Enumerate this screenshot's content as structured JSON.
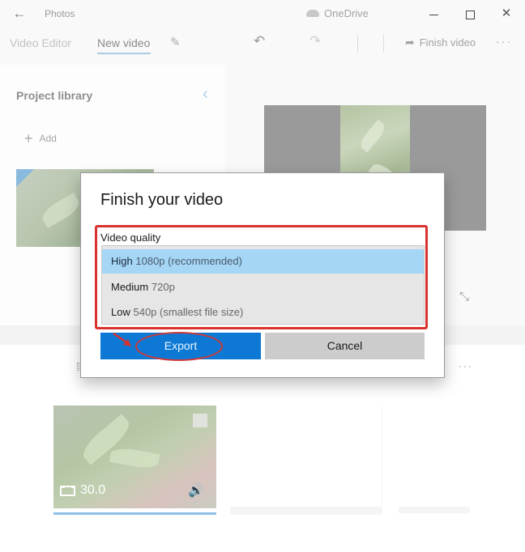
{
  "titlebar": {
    "app_name": "Photos",
    "cloud_label": "OneDrive",
    "back_icon": "arrow-left-icon",
    "minimize_icon": "minimize-icon",
    "maximize_icon": "maximize-icon",
    "close_icon": "close-icon"
  },
  "toolbar": {
    "breadcrumb": [
      "Video Editor",
      "New video"
    ],
    "rename_icon": "pencil-icon",
    "undo_icon": "undo-icon",
    "redo_icon": "redo-icon",
    "finish_label": "Finish video",
    "more_icon": "more-icon"
  },
  "library": {
    "title": "Project library",
    "add_label": "Add",
    "collapse_icon": "chevron-left-icon"
  },
  "preview": {
    "expand_icon": "expand-icon"
  },
  "storyboard": {
    "clip": {
      "duration": "30.0",
      "film_icon": "film-icon",
      "audio_icon": "volume-icon"
    },
    "more_icon": "more-icon"
  },
  "dialog": {
    "title": "Finish your video",
    "quality_label": "Video quality",
    "options": [
      {
        "name": "High",
        "detail": "1080p (recommended)",
        "selected": true
      },
      {
        "name": "Medium",
        "detail": "720p",
        "selected": false
      },
      {
        "name": "Low",
        "detail": "540p (smallest file size)",
        "selected": false
      }
    ],
    "export_label": "Export",
    "cancel_label": "Cancel"
  },
  "colors": {
    "accent": "#0e78d5",
    "selected_option": "#a5d6f6",
    "annotation": "#d9322e"
  }
}
